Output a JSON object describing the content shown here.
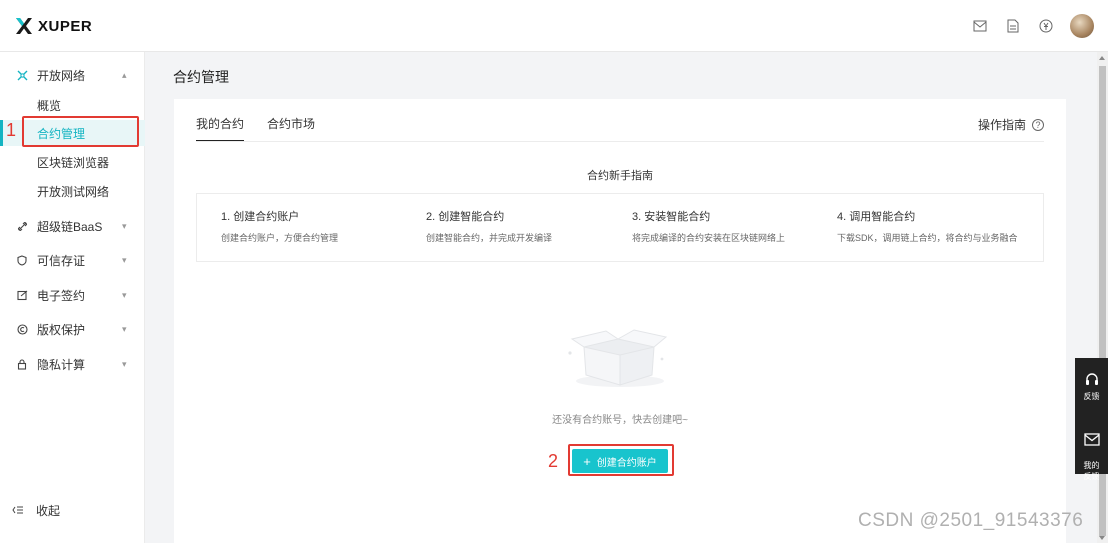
{
  "brand": {
    "name": "XUPER"
  },
  "header": {
    "icons": [
      "mail-icon",
      "document-icon",
      "currency-icon"
    ],
    "avatar": "avatar"
  },
  "sidebar": {
    "groups": [
      {
        "label": "开放网络",
        "icon": "network-icon",
        "expanded": true,
        "children": [
          "概览",
          "合约管理",
          "区块链浏览器",
          "开放测试网络"
        ]
      },
      {
        "label": "超级链BaaS",
        "icon": "chain-icon"
      },
      {
        "label": "可信存证",
        "icon": "shield-icon"
      },
      {
        "label": "电子签约",
        "icon": "sign-icon"
      },
      {
        "label": "版权保护",
        "icon": "copyright-icon"
      },
      {
        "label": "隐私计算",
        "icon": "lock-icon"
      }
    ],
    "active_child": "合约管理",
    "collapse_label": "收起"
  },
  "page": {
    "title": "合约管理"
  },
  "tabs": [
    "我的合约",
    "合约市场"
  ],
  "guide_link": "操作指南",
  "guide": {
    "title": "合约新手指南",
    "steps": [
      {
        "title": "1. 创建合约账户",
        "desc": "创建合约账户，方便合约管理"
      },
      {
        "title": "2. 创建智能合约",
        "desc": "创建智能合约，并完成开发编译"
      },
      {
        "title": "3. 安装智能合约",
        "desc": "将完成编译的合约安装在区块链网络上"
      },
      {
        "title": "4. 调用智能合约",
        "desc": "下载SDK，调用链上合约，将合约与业务融合"
      }
    ]
  },
  "empty": {
    "text": "还没有合约账号，快去创建吧~"
  },
  "create_button": "创建合约账户",
  "annotations": [
    "1",
    "2"
  ],
  "float_panel": [
    "反馈",
    "我的\n反馈"
  ],
  "watermark": "CSDN @2501_91543376",
  "colors": {
    "accent": "#14b4c2",
    "button": "#18c4cd",
    "annotation": "#e23a32"
  }
}
